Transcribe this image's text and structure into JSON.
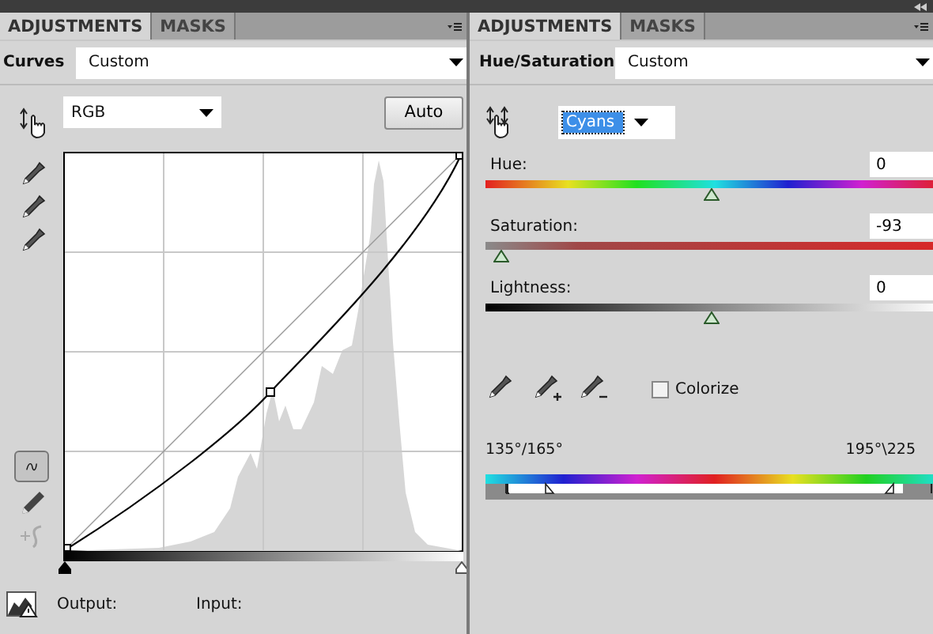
{
  "curves_panel": {
    "tabs": [
      {
        "label": "ADJUSTMENTS",
        "selected": true
      },
      {
        "label": "MASKS",
        "selected": false
      }
    ],
    "adjustment": "Curves",
    "preset": "Custom",
    "channel": "RGB",
    "auto_button": "Auto",
    "output_label": "Output:",
    "input_label": "Input:"
  },
  "hue_saturation_panel": {
    "tabs": [
      {
        "label": "ADJUSTMENTS",
        "selected": true
      },
      {
        "label": "MASKS",
        "selected": false
      }
    ],
    "adjustment": "Hue/Saturation",
    "preset": "Custom",
    "range": "Cyans",
    "sliders": [
      {
        "kind": "hue",
        "label": "Hue:",
        "value": "0",
        "level": 0.5
      },
      {
        "kind": "saturation",
        "label": "Saturation:",
        "value": "-93",
        "level": 0.035
      },
      {
        "kind": "lightness",
        "label": "Lightness:",
        "value": "0",
        "level": 0.5
      }
    ],
    "colorize": {
      "label": "Colorize",
      "checked": false
    },
    "range_labels": [
      "135°/165°",
      "195°\\225"
    ]
  }
}
